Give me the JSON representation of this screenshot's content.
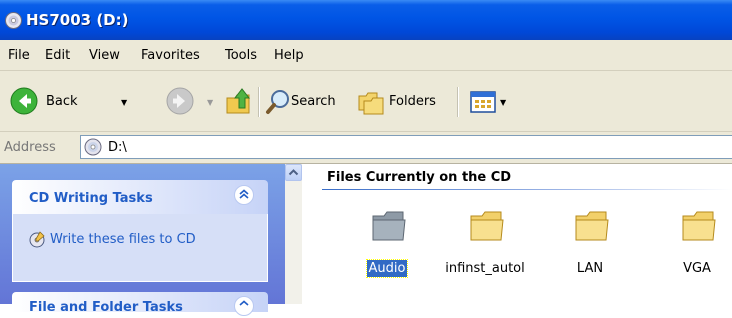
{
  "window": {
    "title": "HS7003 (D:)"
  },
  "menu": {
    "items": [
      "File",
      "Edit",
      "View",
      "Favorites",
      "Tools",
      "Help"
    ]
  },
  "toolbar": {
    "back_label": "Back",
    "search_label": "Search",
    "folders_label": "Folders",
    "icons": [
      "back-arrow-icon",
      "forward-arrow-icon",
      "up-folder-icon",
      "search-magnifier-icon",
      "folders-icon",
      "views-icon"
    ]
  },
  "address": {
    "label": "Address",
    "value": "D:\\"
  },
  "tasks": {
    "cd_writing_title": "CD Writing Tasks",
    "write_files_link": "Write these files to CD",
    "second_panel_title": "File and Folder Tasks"
  },
  "content": {
    "group_title": "Files Currently on the CD",
    "items": [
      {
        "name": "Audio",
        "selected": true
      },
      {
        "name": "infinst_autol",
        "selected": false
      },
      {
        "name": "LAN",
        "selected": false
      },
      {
        "name": "VGA",
        "selected": false
      }
    ]
  },
  "colors": {
    "titlebar": "#0055e5",
    "chrome": "#ece9d8",
    "taskpane": "#6375d6",
    "task_link": "#215dc6",
    "selection": "#316ac5"
  }
}
